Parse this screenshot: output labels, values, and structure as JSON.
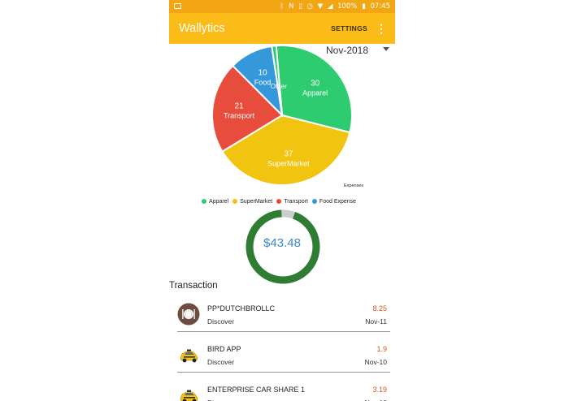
{
  "status_bar": {
    "battery": "100%",
    "time": "07:45"
  },
  "app_bar": {
    "title": "Wallytics",
    "settings_label": "SETTINGS"
  },
  "month_selector": {
    "value": "Nov-2018"
  },
  "chart_data": {
    "type": "pie",
    "slices": [
      {
        "label": "Apparel",
        "value": 30,
        "color": "#2ECC71"
      },
      {
        "label": "SuperMarket",
        "value": 37,
        "color": "#F1C40F"
      },
      {
        "label": "Transport",
        "value": 21,
        "color": "#E74C3C"
      },
      {
        "label": "Food",
        "value": 10,
        "color": "#3498DB"
      },
      {
        "label": "Other",
        "value": 1,
        "color": "#2ECC71"
      }
    ],
    "description": "Expenses",
    "legend": [
      {
        "label": "Apparel",
        "color": "#2ECC71"
      },
      {
        "label": "SuperMarket",
        "color": "#F1C40F"
      },
      {
        "label": "Transport",
        "color": "#E74C3C"
      },
      {
        "label": "Food Expense",
        "color": "#3498DB"
      }
    ]
  },
  "budget_ring": {
    "amount": "$43.48",
    "fraction": 0.94,
    "color": "#2E7D32",
    "remainder_color": "#CCCCCC"
  },
  "transactions_title": "Transaction",
  "transactions": [
    {
      "name": "PP*DUTCHBROLLC",
      "account": "Discover",
      "amount": "8.25",
      "date": "Nov-11",
      "icon": "restaurant-icon"
    },
    {
      "name": "BIRD APP",
      "account": "Discover",
      "amount": "1.9",
      "date": "Nov-10",
      "icon": "taxi-icon"
    },
    {
      "name": "ENTERPRISE CAR SHARE 1",
      "account": "Discover",
      "amount": "3.19",
      "date": "Nov-10",
      "icon": "taxi-icon"
    }
  ]
}
